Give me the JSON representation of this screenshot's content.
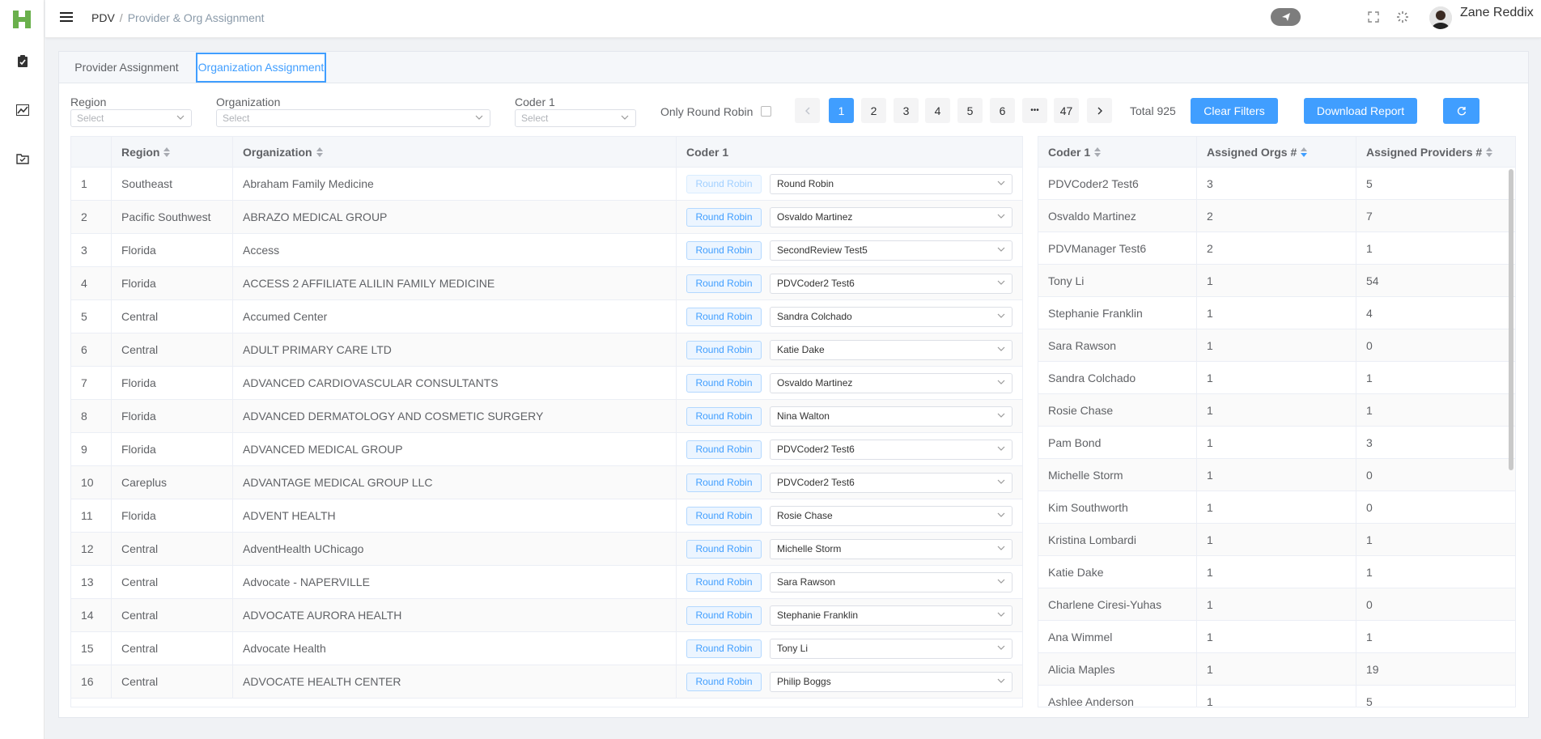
{
  "brand": {
    "logo_letter": "H",
    "logo_color": "#6ab04c"
  },
  "sidebar": {
    "items": [
      {
        "icon": "clipboard-check-icon"
      },
      {
        "icon": "chart-line-icon"
      },
      {
        "icon": "folder-check-icon"
      }
    ]
  },
  "header": {
    "breadcrumb_root": "PDV",
    "breadcrumb_sep": "/",
    "breadcrumb_current": "Provider & Org Assignment",
    "user_name": "Zane Reddix"
  },
  "tabs": [
    {
      "label": "Provider Assignment",
      "active": false
    },
    {
      "label": "Organization Assignment",
      "active": true
    }
  ],
  "filters": {
    "region_label": "Region",
    "region_placeholder": "Select",
    "organization_label": "Organization",
    "organization_placeholder": "Select",
    "coder_label": "Coder 1",
    "coder_placeholder": "Select",
    "round_robin_label": "Only Round Robin",
    "round_robin_checked": false
  },
  "pagination": {
    "pages": [
      "1",
      "2",
      "3",
      "4",
      "5",
      "6",
      "•••",
      "47"
    ],
    "current": "1",
    "total_text": "Total 925"
  },
  "buttons": {
    "clear_filters": "Clear Filters",
    "download_report": "Download Report"
  },
  "accent_color": "#409eff",
  "org_table": {
    "headers": {
      "index": "",
      "region": "Region",
      "organization": "Organization",
      "coder": "Coder 1"
    },
    "round_robin_label": "Round Robin",
    "rows": [
      {
        "index": "1",
        "region": "Southeast",
        "organization": "Abraham Family Medicine",
        "coder": "Round Robin",
        "rr_disabled": true
      },
      {
        "index": "2",
        "region": "Pacific Southwest",
        "organization": "ABRAZO MEDICAL GROUP",
        "coder": "Osvaldo Martinez",
        "rr_disabled": false
      },
      {
        "index": "3",
        "region": "Florida",
        "organization": "Access",
        "coder": "SecondReview Test5",
        "rr_disabled": false
      },
      {
        "index": "4",
        "region": "Florida",
        "organization": "ACCESS 2 AFFILIATE ALILIN FAMILY MEDICINE",
        "coder": "PDVCoder2 Test6",
        "rr_disabled": false
      },
      {
        "index": "5",
        "region": "Central",
        "organization": "Accumed Center",
        "coder": "Sandra Colchado",
        "rr_disabled": false
      },
      {
        "index": "6",
        "region": "Central",
        "organization": "ADULT PRIMARY CARE LTD",
        "coder": "Katie Dake",
        "rr_disabled": false
      },
      {
        "index": "7",
        "region": "Florida",
        "organization": "ADVANCED CARDIOVASCULAR CONSULTANTS",
        "coder": "Osvaldo Martinez",
        "rr_disabled": false
      },
      {
        "index": "8",
        "region": "Florida",
        "organization": "ADVANCED DERMATOLOGY AND COSMETIC SURGERY",
        "coder": "Nina Walton",
        "rr_disabled": false
      },
      {
        "index": "9",
        "region": "Florida",
        "organization": "ADVANCED MEDICAL GROUP",
        "coder": "PDVCoder2 Test6",
        "rr_disabled": false
      },
      {
        "index": "10",
        "region": "Careplus",
        "organization": "ADVANTAGE MEDICAL GROUP LLC",
        "coder": "PDVCoder2 Test6",
        "rr_disabled": false
      },
      {
        "index": "11",
        "region": "Florida",
        "organization": "ADVENT HEALTH",
        "coder": "Rosie Chase",
        "rr_disabled": false
      },
      {
        "index": "12",
        "region": "Central",
        "organization": "AdventHealth UChicago",
        "coder": "Michelle Storm",
        "rr_disabled": false
      },
      {
        "index": "13",
        "region": "Central",
        "organization": "Advocate - NAPERVILLE",
        "coder": "Sara Rawson",
        "rr_disabled": false
      },
      {
        "index": "14",
        "region": "Central",
        "organization": "ADVOCATE AURORA HEALTH",
        "coder": "Stephanie Franklin",
        "rr_disabled": false
      },
      {
        "index": "15",
        "region": "Central",
        "organization": "Advocate Health",
        "coder": "Tony Li",
        "rr_disabled": false
      },
      {
        "index": "16",
        "region": "Central",
        "organization": "ADVOCATE HEALTH CENTER",
        "coder": "Philip Boggs",
        "rr_disabled": false
      }
    ]
  },
  "summary_table": {
    "headers": {
      "coder": "Coder 1",
      "orgs": "Assigned Orgs #",
      "providers": "Assigned Providers #"
    },
    "rows": [
      {
        "coder": "PDVCoder2 Test6",
        "orgs": "3",
        "providers": "5"
      },
      {
        "coder": "Osvaldo Martinez",
        "orgs": "2",
        "providers": "7"
      },
      {
        "coder": "PDVManager Test6",
        "orgs": "2",
        "providers": "1"
      },
      {
        "coder": "Tony Li",
        "orgs": "1",
        "providers": "54"
      },
      {
        "coder": "Stephanie Franklin",
        "orgs": "1",
        "providers": "4"
      },
      {
        "coder": "Sara Rawson",
        "orgs": "1",
        "providers": "0"
      },
      {
        "coder": "Sandra Colchado",
        "orgs": "1",
        "providers": "1"
      },
      {
        "coder": "Rosie Chase",
        "orgs": "1",
        "providers": "1"
      },
      {
        "coder": "Pam Bond",
        "orgs": "1",
        "providers": "3"
      },
      {
        "coder": "Michelle Storm",
        "orgs": "1",
        "providers": "0"
      },
      {
        "coder": "Kim Southworth",
        "orgs": "1",
        "providers": "0"
      },
      {
        "coder": "Kristina Lombardi",
        "orgs": "1",
        "providers": "1"
      },
      {
        "coder": "Katie Dake",
        "orgs": "1",
        "providers": "1"
      },
      {
        "coder": "Charlene Ciresi-Yuhas",
        "orgs": "1",
        "providers": "0"
      },
      {
        "coder": "Ana Wimmel",
        "orgs": "1",
        "providers": "1"
      },
      {
        "coder": "Alicia Maples",
        "orgs": "1",
        "providers": "19"
      },
      {
        "coder": "Ashlee Anderson",
        "orgs": "1",
        "providers": "5"
      }
    ]
  }
}
